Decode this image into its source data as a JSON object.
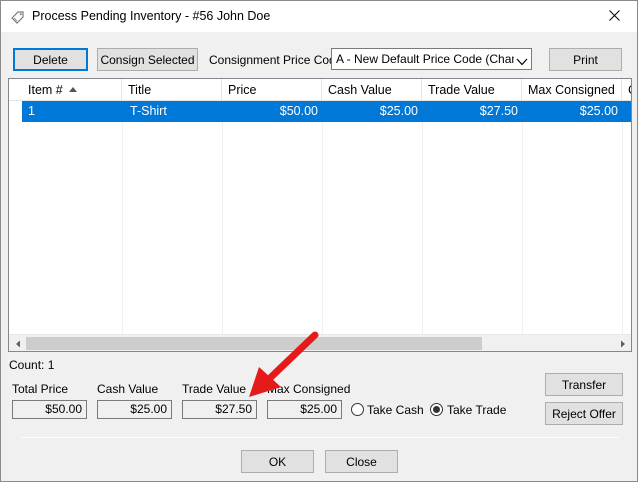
{
  "window": {
    "title": "Process Pending Inventory - #56 John Doe",
    "title_icon": "tag-icon",
    "close_icon": "close-icon"
  },
  "toolbar": {
    "delete_label": "Delete",
    "consign_label": "Consign Selected",
    "price_code_label": "Consignment Price Code",
    "price_code_value": "A - New Default Price Code (Changed",
    "print_label": "Print"
  },
  "grid": {
    "columns": [
      "Item #",
      "Title",
      "Price",
      "Cash Value",
      "Trade Value",
      "Max Consigned",
      "C"
    ],
    "sorted_column": "Item #",
    "rows": [
      {
        "item": "1",
        "title": "T-Shirt",
        "price": "$50.00",
        "cash": "$25.00",
        "trade": "$27.50",
        "max": "$25.00"
      }
    ]
  },
  "summary": {
    "count_text": "Count: 1",
    "total_price_label": "Total Price",
    "total_price_value": "$50.00",
    "cash_value_label": "Cash Value",
    "cash_value_value": "$25.00",
    "trade_value_label": "Trade Value",
    "trade_value_value": "$27.50",
    "max_consigned_label": "Max Consigned",
    "max_consigned_value": "$25.00",
    "take_cash_label": "Take Cash",
    "take_trade_label": "Take Trade",
    "selected_option": "Take Trade"
  },
  "side_actions": {
    "transfer_label": "Transfer",
    "reject_label": "Reject Offer"
  },
  "footer": {
    "ok_label": "OK",
    "close_label": "Close"
  },
  "colors": {
    "selection": "#0078d7",
    "annotation_arrow": "#e51b1b"
  }
}
